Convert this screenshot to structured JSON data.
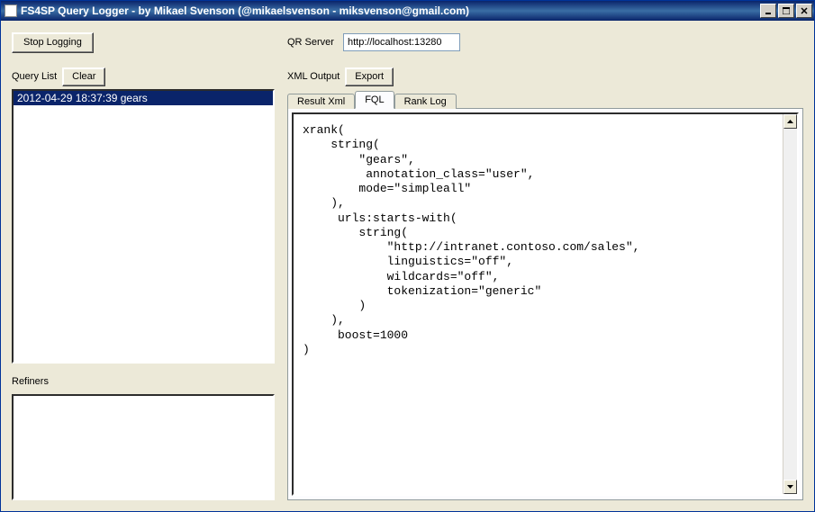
{
  "window": {
    "title": "FS4SP Query Logger - by Mikael Svenson (@mikaelsvenson - miksvenson@gmail.com)"
  },
  "toolbar": {
    "stop_logging": "Stop Logging",
    "qr_server_label": "QR Server",
    "qr_server_value": "http://localhost:13280"
  },
  "query_list": {
    "label": "Query List",
    "clear": "Clear",
    "items": [
      {
        "text": "2012-04-29 18:37:39 gears",
        "selected": true
      }
    ]
  },
  "refiners": {
    "label": "Refiners"
  },
  "xml_output": {
    "label": "XML Output",
    "export": "Export",
    "tabs": {
      "result_xml": "Result Xml",
      "fql": "FQL",
      "rank_log": "Rank Log",
      "active": "fql"
    },
    "fql_content": "xrank(\n    string(\n        \"gears\",\n         annotation_class=\"user\",\n        mode=\"simpleall\"\n    ),\n     urls:starts-with(\n        string(\n            \"http://intranet.contoso.com/sales\",\n            linguistics=\"off\",\n            wildcards=\"off\",\n            tokenization=\"generic\"\n        )\n    ),\n     boost=1000\n)"
  }
}
